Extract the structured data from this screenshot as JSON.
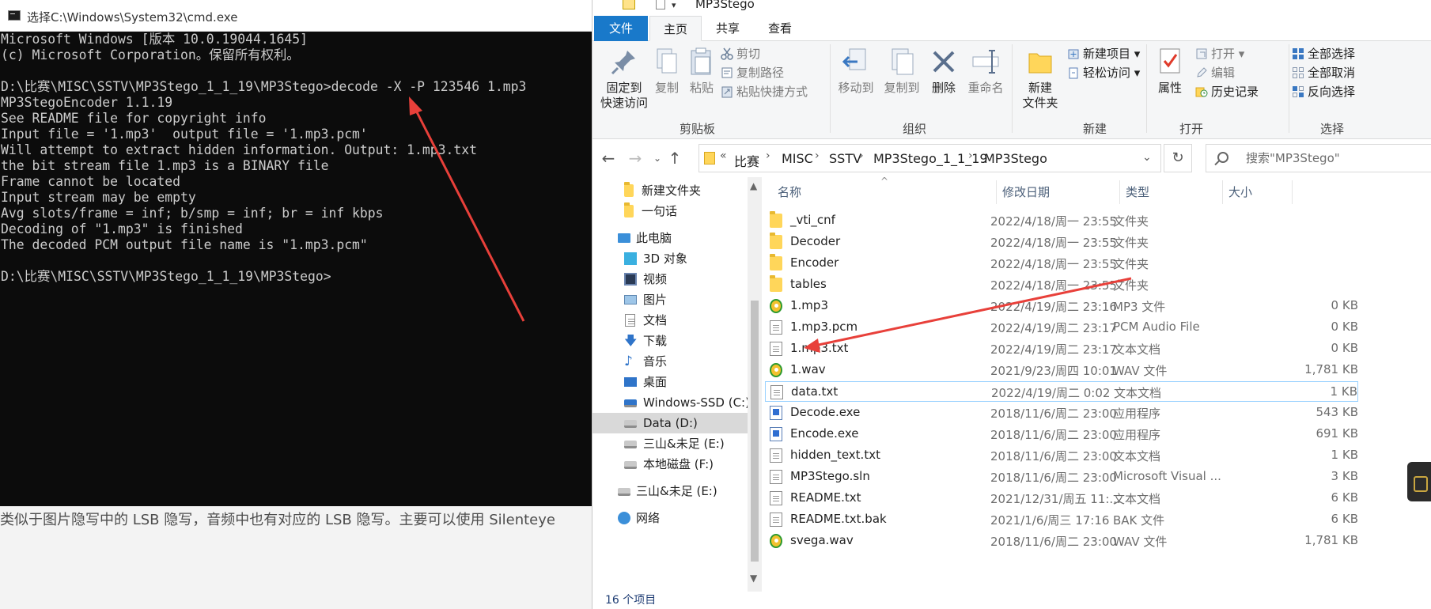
{
  "cmd": {
    "title": "选择C:\\Windows\\System32\\cmd.exe",
    "lines": [
      "Microsoft Windows [版本 10.0.19044.1645]",
      "(c) Microsoft Corporation。保留所有权利。",
      "",
      "D:\\比赛\\MISC\\SSTV\\MP3Stego_1_1_19\\MP3Stego>decode -X -P 123546 1.mp3",
      "MP3StegoEncoder 1.1.19",
      "See README file for copyright info",
      "Input file = '1.mp3'  output file = '1.mp3.pcm'",
      "Will attempt to extract hidden information. Output: 1.mp3.txt",
      "the bit stream file 1.mp3 is a BINARY file",
      "Frame cannot be located",
      "Input stream may be empty",
      "Avg slots/frame = inf; b/smp = inf; br = inf kbps",
      "Decoding of \"1.mp3\" is finished",
      "The decoded PCM output file name is \"1.mp3.pcm\"",
      "",
      "D:\\比赛\\MISC\\SSTV\\MP3Stego_1_1_19\\MP3Stego>"
    ]
  },
  "background_text": "类似于图片隐写中的 LSB 隐写，音频中也有对应的 LSB 隐写。主要可以使用 Silenteye",
  "explorer": {
    "title": "MP3Stego",
    "tabs": [
      "文件",
      "主页",
      "共享",
      "查看"
    ],
    "ribbon": {
      "pin": "固定到\n快速访问",
      "copy": "复制",
      "paste": "粘贴",
      "cut": "剪切",
      "copy_path": "复制路径",
      "paste_shortcut": "粘贴快捷方式",
      "group_clipboard": "剪贴板",
      "move_to": "移动到",
      "copy_to": "复制到",
      "delete": "删除",
      "rename": "重命名",
      "group_organize": "组织",
      "new_folder": "新建\n文件夹",
      "new_item": "新建项目",
      "easy_access": "轻松访问",
      "group_new": "新建",
      "properties": "属性",
      "open": "打开",
      "edit": "编辑",
      "history": "历史记录",
      "group_open": "打开",
      "select_all": "全部选择",
      "select_none": "全部取消",
      "invert_selection": "反向选择",
      "group_select": "选择"
    },
    "address": {
      "crumbs": [
        "比赛",
        "MISC",
        "SSTV",
        "MP3Stego_1_1_19",
        "MP3Stego"
      ],
      "search_placeholder": "搜索\"MP3Stego\""
    },
    "nav": [
      {
        "label": "新建文件夹",
        "icon": "folder-icon"
      },
      {
        "label": "一句话",
        "icon": "folder-icon"
      },
      {
        "label": "此电脑",
        "icon": "computer-icon"
      },
      {
        "label": "3D 对象",
        "icon": "3d-objects-icon"
      },
      {
        "label": "视频",
        "icon": "video-icon"
      },
      {
        "label": "图片",
        "icon": "pictures-icon"
      },
      {
        "label": "文档",
        "icon": "documents-icon"
      },
      {
        "label": "下载",
        "icon": "downloads-icon"
      },
      {
        "label": "音乐",
        "icon": "music-icon"
      },
      {
        "label": "桌面",
        "icon": "desktop-icon"
      },
      {
        "label": "Windows-SSD (C:)",
        "icon": "drive-icon"
      },
      {
        "label": "Data (D:)",
        "icon": "drive-icon"
      },
      {
        "label": "三山&未足 (E:)",
        "icon": "drive-icon"
      },
      {
        "label": "本地磁盘 (F:)",
        "icon": "drive-icon"
      },
      {
        "label": "三山&未足 (E:)",
        "icon": "drive-icon"
      },
      {
        "label": "网络",
        "icon": "network-icon"
      }
    ],
    "columns": [
      "名称",
      "修改日期",
      "类型",
      "大小"
    ],
    "files": [
      {
        "name": "_vti_cnf",
        "date": "2022/4/18/周一 23:55",
        "type": "文件夹",
        "size": "",
        "icon": "folder"
      },
      {
        "name": "Decoder",
        "date": "2022/4/18/周一 23:55",
        "type": "文件夹",
        "size": "",
        "icon": "folder"
      },
      {
        "name": "Encoder",
        "date": "2022/4/18/周一 23:55",
        "type": "文件夹",
        "size": "",
        "icon": "folder"
      },
      {
        "name": "tables",
        "date": "2022/4/18/周一 23:55",
        "type": "文件夹",
        "size": "",
        "icon": "folder"
      },
      {
        "name": "1.mp3",
        "date": "2022/4/19/周二 23:16",
        "type": "MP3 文件",
        "size": "0 KB",
        "icon": "media"
      },
      {
        "name": "1.mp3.pcm",
        "date": "2022/4/19/周二 23:17",
        "type": "PCM Audio File",
        "size": "0 KB",
        "icon": "doc"
      },
      {
        "name": "1.mp3.txt",
        "date": "2022/4/19/周二 23:17",
        "type": "文本文档",
        "size": "0 KB",
        "icon": "doc"
      },
      {
        "name": "1.wav",
        "date": "2021/9/23/周四 10:01",
        "type": "WAV 文件",
        "size": "1,781 KB",
        "icon": "media"
      },
      {
        "name": "data.txt",
        "date": "2022/4/19/周二 0:02",
        "type": "文本文档",
        "size": "1 KB",
        "icon": "doc"
      },
      {
        "name": "Decode.exe",
        "date": "2018/11/6/周二 23:00",
        "type": "应用程序",
        "size": "543 KB",
        "icon": "exe"
      },
      {
        "name": "Encode.exe",
        "date": "2018/11/6/周二 23:00",
        "type": "应用程序",
        "size": "691 KB",
        "icon": "exe"
      },
      {
        "name": "hidden_text.txt",
        "date": "2018/11/6/周二 23:00",
        "type": "文本文档",
        "size": "1 KB",
        "icon": "doc"
      },
      {
        "name": "MP3Stego.sln",
        "date": "2018/11/6/周二 23:00",
        "type": "Microsoft Visual ...",
        "size": "3 KB",
        "icon": "doc"
      },
      {
        "name": "README.txt",
        "date": "2021/12/31/周五 11:...",
        "type": "文本文档",
        "size": "6 KB",
        "icon": "doc"
      },
      {
        "name": "README.txt.bak",
        "date": "2021/1/6/周三 17:16",
        "type": "BAK 文件",
        "size": "6 KB",
        "icon": "doc"
      },
      {
        "name": "svega.wav",
        "date": "2018/11/6/周二 23:00",
        "type": "WAV 文件",
        "size": "1,781 KB",
        "icon": "media"
      }
    ],
    "status": "16 个项目"
  },
  "colors": {
    "annotation_arrow": "#e8403a",
    "file_tab": "#1979ca",
    "cmd_bg": "#0c0c0c"
  }
}
